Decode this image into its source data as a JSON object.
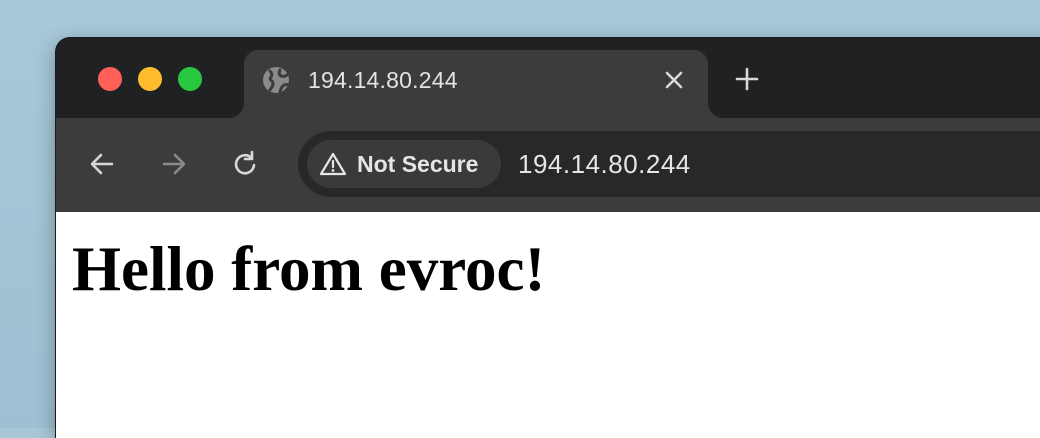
{
  "window": {
    "controls": [
      "close",
      "minimize",
      "maximize"
    ],
    "colors": {
      "close": "#fe5f57",
      "minimize": "#febc2e",
      "maximize": "#28c840"
    }
  },
  "tab": {
    "title": "194.14.80.244",
    "icon": "globe-icon",
    "close_icon": "close-icon"
  },
  "new_tab_icon": "plus-icon",
  "toolbar": {
    "back_icon": "arrow-left-icon",
    "forward_icon": "arrow-right-icon",
    "reload_icon": "reload-icon"
  },
  "address_bar": {
    "security_label": "Not Secure",
    "security_icon": "warning-triangle-icon",
    "url": "194.14.80.244"
  },
  "page": {
    "heading": "Hello from evroc!"
  }
}
